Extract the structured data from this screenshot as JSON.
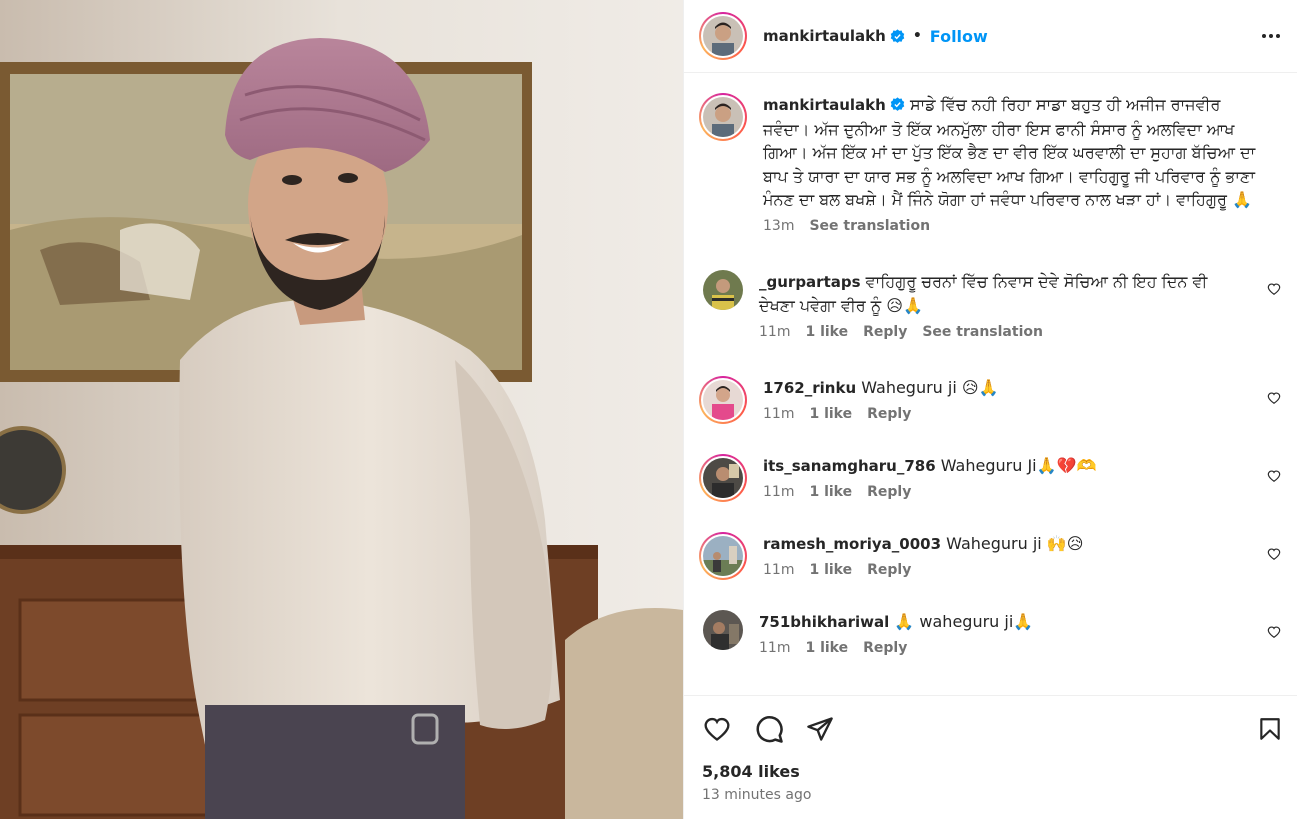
{
  "post": {
    "username": "mankirtaulakh",
    "follow_label": "Follow",
    "separator": "•",
    "caption": "ਸਾਡੇ ਵਿੱਚ ਨਹੀ ਰਿਹਾ ਸਾਡਾ ਬਹੁਤ ਹੀ ਅਜੀਜ ਰਾਜਵੀਰ ਜਵੰਦਾ। ਅੱਜ ਦੁਨੀਆ ਤੋ ਇੱਕ ਅਨਮੁੱਲਾ ਹੀਰਾ ਇਸ ਫਾਨੀ ਸੰਸਾਰ ਨੂੰ ਅਲਵਿਦਾ ਆਖ ਗਿਆ। ਅੱਜ ਇੱਕ ਮਾਂ ਦਾ ਪੁੱਤ ਇੱਕ ਭੈਣ ਦਾ ਵੀਰ ਇੱਕ ਘਰਵਾਲੀ ਦਾ ਸੁਹਾਗ ਬੱਚਿਆ ਦਾ ਬਾਪ ਤੇ ਯਾਰਾ ਦਾ ਯਾਰ ਸਭ ਨੂੰ ਅਲਵਿਦਾ ਆਖ ਗਿਆ। ਵਾਹਿਗੁਰੂ ਜੀ ਪਰਿਵਾਰ ਨੂੰ ਭਾਣਾ ਮੰਨਣ ਦਾ ਬਲ ਬਖਸ਼ੇ। ਮੈਂ ਜਿੰਨੇ ਯੋਗਾ ਹਾਂ ਜਵੰਧਾ ਪਰਿਵਾਰ ਨਾਲ ਖੜਾ ਹਾਂ। ਵਾਹਿਗੁਰੂ 🙏",
    "caption_age": "13m",
    "see_translation": "See translation",
    "likes": "5,804 likes",
    "posted": "13 minutes ago"
  },
  "comments": [
    {
      "user": "_gurpartaps",
      "text": "ਵਾਹਿਗੁਰੂ ਚਰਨਾਂ ਵਿੱਚ ਨਿਵਾਸ ਦੇਵੇ ਸੋਚਿਆ ਨੀ ਇਹ ਦਿਨ ਵੀ ਦੇਖਣਾ ਪਵੇਗਾ ਵੀਰ ਨੂੰ 😥🙏",
      "age": "11m",
      "likes": "1 like",
      "reply": "Reply",
      "translate": "See translation"
    },
    {
      "user": "1762_rinku",
      "text": "Waheguru ji 😥🙏",
      "age": "11m",
      "likes": "1 like",
      "reply": "Reply"
    },
    {
      "user": "its_sanamgharu_786",
      "text": "Waheguru Ji🙏💔🫶",
      "age": "11m",
      "likes": "1 like",
      "reply": "Reply"
    },
    {
      "user": "ramesh_moriya_0003",
      "text": "Waheguru ji 🙌😥",
      "age": "11m",
      "likes": "1 like",
      "reply": "Reply"
    },
    {
      "user": "751bhikhariwal",
      "text": "🙏 waheguru ji🙏",
      "age": "11m",
      "likes": "1 like",
      "reply": "Reply"
    }
  ],
  "icons": {
    "header": [
      "verified-icon",
      "more-options-icon"
    ],
    "footer": [
      "like-heart-icon",
      "comment-icon",
      "share-icon",
      "save-bookmark-icon"
    ],
    "comment": "comment-like-heart-icon"
  },
  "colors": {
    "accent": "#0095f6",
    "muted": "#737373",
    "text": "#262626",
    "verified": "#0095f6"
  }
}
